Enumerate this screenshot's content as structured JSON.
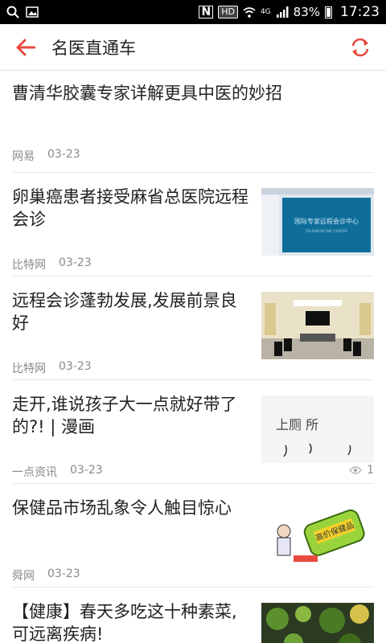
{
  "status_bar": {
    "battery": "83%",
    "time": "17:23",
    "network": "4G",
    "hd": "HD"
  },
  "app_bar": {
    "title": "名医直通车",
    "accent_color": "#e94a3f"
  },
  "articles": [
    {
      "title": "曹清华胶囊专家详解更具中医的妙招",
      "source": "网易",
      "date": "03-23",
      "has_image": false
    },
    {
      "title": "卵巢癌患者接受麻省总医院远程会诊",
      "source": "比特网",
      "date": "03-23",
      "has_image": true,
      "image": "telemedicine-screen"
    },
    {
      "title": "远程会诊蓬勃发展,发展前景良好",
      "source": "比特网",
      "date": "03-23",
      "has_image": true,
      "image": "conference-room"
    },
    {
      "title": "走开,谁说孩子大一点就好带了的?! | 漫画",
      "source": "一点资讯",
      "date": "03-23",
      "has_image": true,
      "image": "comic-sketch",
      "views": "1"
    },
    {
      "title": "保健品市场乱象令人触目惊心",
      "source": "舜网",
      "date": "03-23",
      "has_image": true,
      "image": "health-supplement-cartoon"
    },
    {
      "title": "【健康】春天多吃这十种素菜,可远离疾病!",
      "source": "",
      "date": "",
      "has_image": true,
      "image": "vegetables"
    }
  ],
  "thumb_texts": {
    "screen": "国际专家远程会诊中心",
    "screen_sub": "TELEMEDICINE CENTER",
    "comic": "上厕 所",
    "label": "高价保健品"
  }
}
